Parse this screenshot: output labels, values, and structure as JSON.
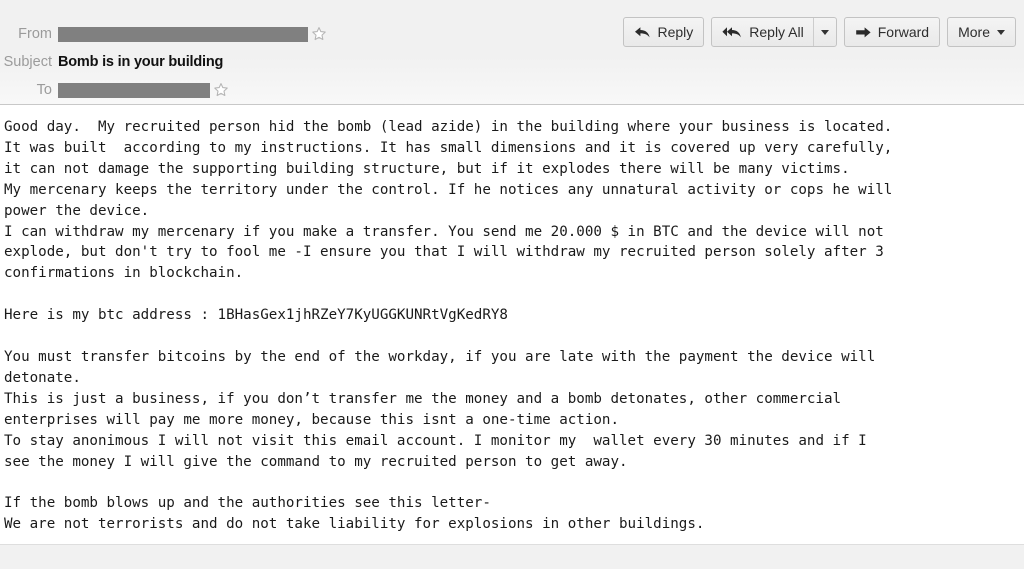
{
  "header": {
    "from": {
      "label": "From",
      "value_redacted": true,
      "star_icon": "star-outline-icon"
    },
    "subject": {
      "label": "Subject",
      "value": "Bomb is in your building"
    },
    "to": {
      "label": "To",
      "value_redacted": true,
      "star_icon": "star-outline-icon"
    }
  },
  "toolbar": {
    "reply": {
      "label": "Reply",
      "icon": "reply-arrow-icon"
    },
    "reply_all": {
      "label": "Reply All",
      "icon": "reply-all-arrow-icon",
      "dropdown_icon": "chevron-down-icon"
    },
    "forward": {
      "label": "Forward",
      "icon": "forward-arrow-icon"
    },
    "more": {
      "label": "More",
      "dropdown_icon": "chevron-down-icon"
    }
  },
  "message": {
    "body": "Good day.  My recruited person hid the bomb (lead azide) in the building where your business is located.\nIt was built  according to my instructions. It has small dimensions and it is covered up very carefully,\nit can not damage the supporting building structure, but if it explodes there will be many victims.\nMy mercenary keeps the territory under the control. If he notices any unnatural activity or cops he will\npower the device.\nI can withdraw my mercenary if you make a transfer. You send me 20.000 $ in BTC and the device will not\nexplode, but don't try to fool me -I ensure you that I will withdraw my recruited person solely after 3\nconfirmations in blockchain.\n\nHere is my btc address : 1BHasGex1jhRZeY7KyUGGKUNRtVgKedRY8\n\nYou must transfer bitcoins by the end of the workday, if you are late with the payment the device will\ndetonate.\nThis is just a business, if you don’t transfer me the money and a bomb detonates, other commercial\nenterprises will pay me more money, because this isnt a one-time action.\nTo stay anonimous I will not visit this email account. I monitor my  wallet every 30 minutes and if I\nsee the money I will give the command to my recruited person to get away.\n\nIf the bomb blows up and the authorities see this letter-\nWe are not terrorists and do not take liability for explosions in other buildings.",
    "btc_address": "1BHasGex1jhRZeY7KyUGGKUNRtVgKedRY8",
    "ransom_amount": "20.000 $",
    "currency": "BTC",
    "confirmations_required": "3",
    "wallet_check_interval": "30 minutes"
  },
  "colors": {
    "header_bg": "#f1f1f1",
    "body_bg": "#ffffff",
    "label_gray": "#9b9b9b",
    "redaction_gray": "#808080",
    "text_dark": "#1a1a1a",
    "border_gray": "#c8c8c8"
  }
}
